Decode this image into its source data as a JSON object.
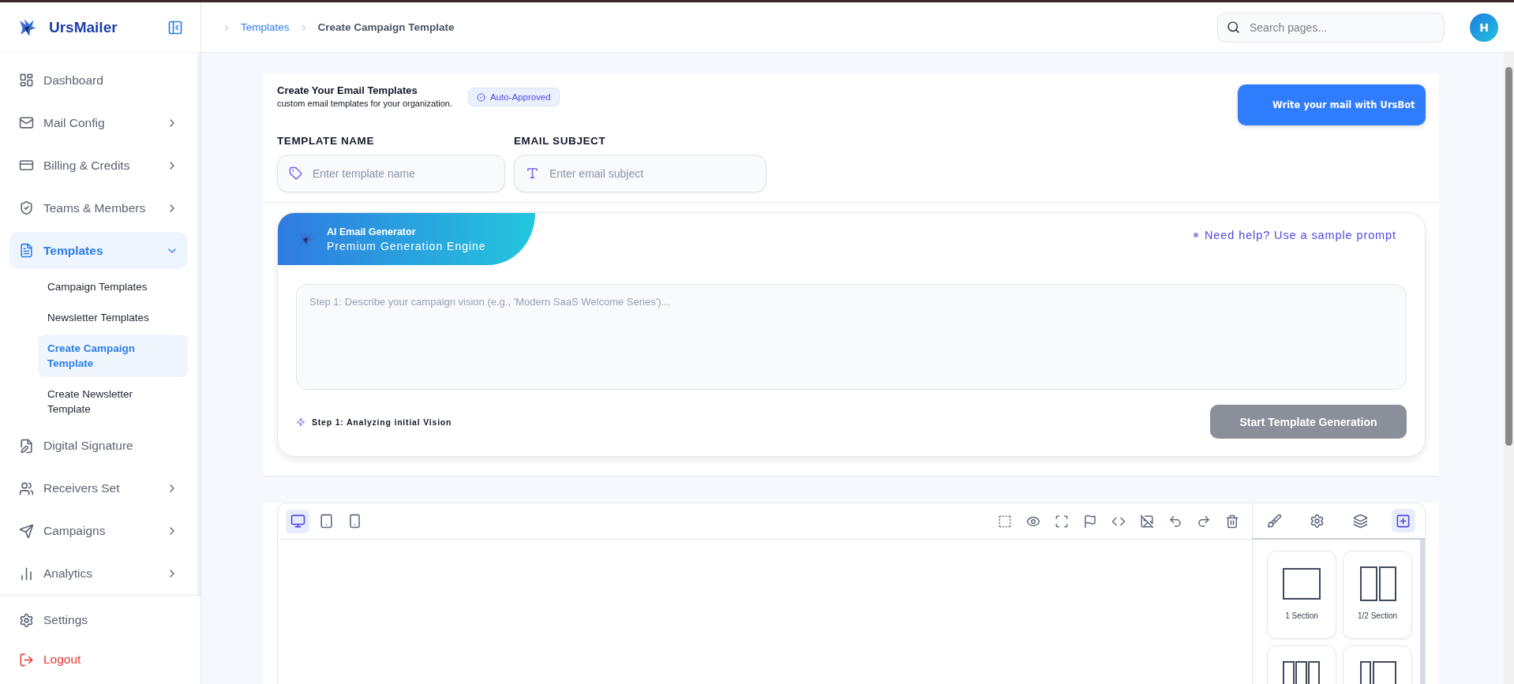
{
  "app": {
    "name": "UrsMailer"
  },
  "sidebar": {
    "items": [
      {
        "label": "Dashboard",
        "selected": false
      },
      {
        "label": "Mail Config",
        "selected": false,
        "expanded": false
      },
      {
        "label": "Billing & Credits",
        "selected": false,
        "expanded": false
      },
      {
        "label": "Teams & Members",
        "selected": false,
        "expanded": false
      },
      {
        "label": "Templates",
        "selected": true,
        "expanded": true,
        "children": [
          {
            "label": "Campaign Templates",
            "selected": false
          },
          {
            "label": "Newsletter Templates",
            "selected": false
          },
          {
            "label": "Create Campaign Template",
            "selected": true
          },
          {
            "label": "Create Newsletter Template",
            "selected": false
          }
        ]
      },
      {
        "label": "Digital Signature",
        "selected": false
      },
      {
        "label": "Receivers Set",
        "selected": false,
        "expanded": false
      },
      {
        "label": "Campaigns",
        "selected": false,
        "expanded": false
      },
      {
        "label": "Analytics",
        "selected": false,
        "expanded": false
      }
    ],
    "footer": [
      {
        "label": "Settings",
        "kind": "normal"
      },
      {
        "label": "Logout",
        "kind": "danger"
      }
    ]
  },
  "breadcrumb": [
    {
      "label": "Templates",
      "kind": "link"
    },
    {
      "label": "Create Campaign Template",
      "kind": "current"
    }
  ],
  "search": {
    "placeholder": "Search pages..."
  },
  "avatar": {
    "initial": "H"
  },
  "template_header": {
    "title": "Create Your Email Templates",
    "subtitle": "custom email templates for your organization.",
    "badge": "Auto-Approved",
    "ursbot_button": "Write your mail with UrsBot"
  },
  "fields": [
    {
      "label": "TEMPLATE NAME",
      "placeholder": "Enter template name",
      "kind": "tag"
    },
    {
      "label": "EMAIL SUBJECT",
      "placeholder": "Enter email subject",
      "kind": "text"
    }
  ],
  "ai_generator": {
    "title": "AI Email Generator",
    "subtitle": "Premium Generation Engine",
    "help_link": "Need help? Use a sample prompt",
    "prompt_placeholder": "Step 1: Describe your campaign vision (e.g., 'Modern SaaS Welcome Series')...",
    "status": "Step 1: Analyzing initial Vision",
    "button": "Start Template Generation"
  },
  "editor": {
    "devices": [
      {
        "kind": "desktop",
        "selected": true
      },
      {
        "kind": "tablet",
        "selected": false
      },
      {
        "kind": "mobile",
        "selected": false
      }
    ],
    "panel_tabs": [
      {
        "kind": "style",
        "selected": false
      },
      {
        "kind": "settings",
        "selected": false
      },
      {
        "kind": "layers",
        "selected": false
      },
      {
        "kind": "blocks",
        "selected": true
      }
    ],
    "blocks": [
      {
        "label": "1 Section",
        "kind": "one"
      },
      {
        "label": "1/2 Section",
        "kind": "half"
      },
      {
        "kind": "three"
      },
      {
        "kind": "third"
      }
    ]
  }
}
